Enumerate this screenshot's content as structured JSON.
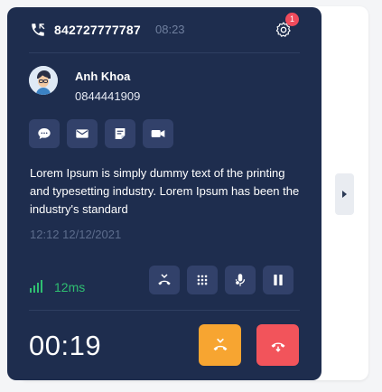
{
  "colors": {
    "card_background": "#1e2d4e",
    "button_background": "#32416a",
    "muted_text": "#6f7f9e",
    "signal_green": "#2fbf71",
    "badge_red": "#f04b5c",
    "transfer_orange": "#f7a531",
    "hangup_red": "#f2545b"
  },
  "header": {
    "caller_number": "842727777787",
    "call_time": "08:23",
    "settings_icon": "gear-icon",
    "notification_count": "1"
  },
  "contact": {
    "name": "Anh Khoa",
    "phone": "0844441909",
    "avatar_icon": "avatar"
  },
  "actions": [
    {
      "icon": "chat-icon"
    },
    {
      "icon": "mail-icon"
    },
    {
      "icon": "note-icon"
    },
    {
      "icon": "video-icon"
    }
  ],
  "note": {
    "text": "Lorem Ipsum is simply dummy text of the printing and typesetting industry. Lorem Ipsum has been the industry's standard",
    "timestamp": "12:12 12/12/2021"
  },
  "status": {
    "latency": "12ms",
    "signal_icon": "signal-icon"
  },
  "controls": [
    {
      "icon": "transfer-icon"
    },
    {
      "icon": "keypad-icon"
    },
    {
      "icon": "microphone-icon"
    },
    {
      "icon": "pause-icon"
    }
  ],
  "call": {
    "duration": "00:19"
  }
}
